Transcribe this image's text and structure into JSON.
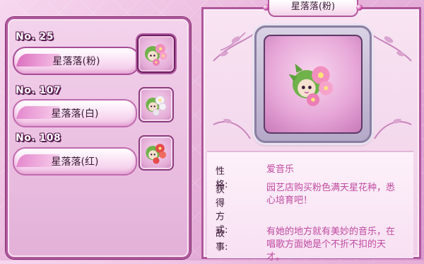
{
  "list": {
    "items": [
      {
        "no": "No. 25",
        "name": "星落落(粉)",
        "selected": true
      },
      {
        "no": "No. 107",
        "name": "星落落(白)",
        "selected": false
      },
      {
        "no": "No. 108",
        "name": "星落落(红)",
        "selected": false
      }
    ]
  },
  "detail": {
    "title": "星落落(粉)",
    "personality_label": "性格:",
    "personality_value": "爱音乐",
    "obtain_label": "获得方式:",
    "obtain_value_line1": "园艺店购买粉色满天星花种，悉",
    "obtain_value_line2": "心培育吧！",
    "story_label": "故事:",
    "story_value_line1": "有她的地方就有美妙的音乐，在",
    "story_value_line2": "唱歌方面她是个不折不扣的天",
    "story_value_line3": "才。"
  },
  "colors": {
    "accent": "#b0579c",
    "value_text": "#c04aa0",
    "pink_flower": "#f28fbf",
    "white_flower": "#f4f1f6",
    "red_flower": "#e64a4a"
  }
}
